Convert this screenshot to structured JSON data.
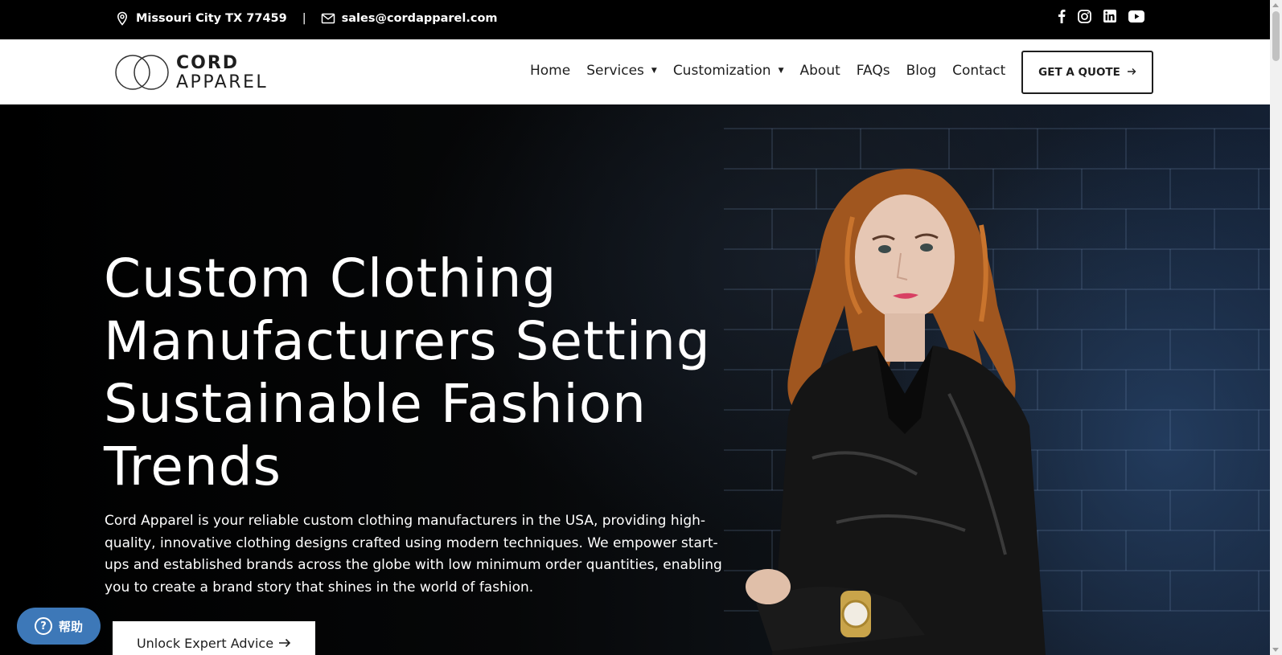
{
  "topbar": {
    "address": "Missouri City TX 77459",
    "separator": "|",
    "email": "sales@cordapparel.com",
    "social_icons": [
      "facebook-icon",
      "instagram-icon",
      "linkedin-icon",
      "youtube-icon"
    ]
  },
  "header": {
    "logo_line1": "CORD",
    "logo_line2": "APPAREL",
    "nav": {
      "home": "Home",
      "services": "Services",
      "customization": "Customization",
      "about": "About",
      "faqs": "FAQs",
      "blog": "Blog",
      "contact": "Contact"
    },
    "quote_label": "GET A QUOTE"
  },
  "hero": {
    "title_lines": [
      "Custom Clothing",
      "Manufacturers Setting",
      "Sustainable Fashion",
      "Trends"
    ],
    "description": "Cord Apparel is your reliable custom clothing manufacturers in the USA, providing high-quality, innovative clothing designs crafted using modern techniques. We empower start-ups and established brands across the globe with low minimum order quantities, enabling you to create a brand story that shines in the world of fashion.",
    "cta_label": "Unlock Expert Advice"
  },
  "help": {
    "label": "帮助"
  },
  "colors": {
    "topbar_bg": "#000000",
    "header_bg": "#ffffff",
    "text_dark": "#1e1e1e",
    "help_bg": "#3d78b8"
  }
}
